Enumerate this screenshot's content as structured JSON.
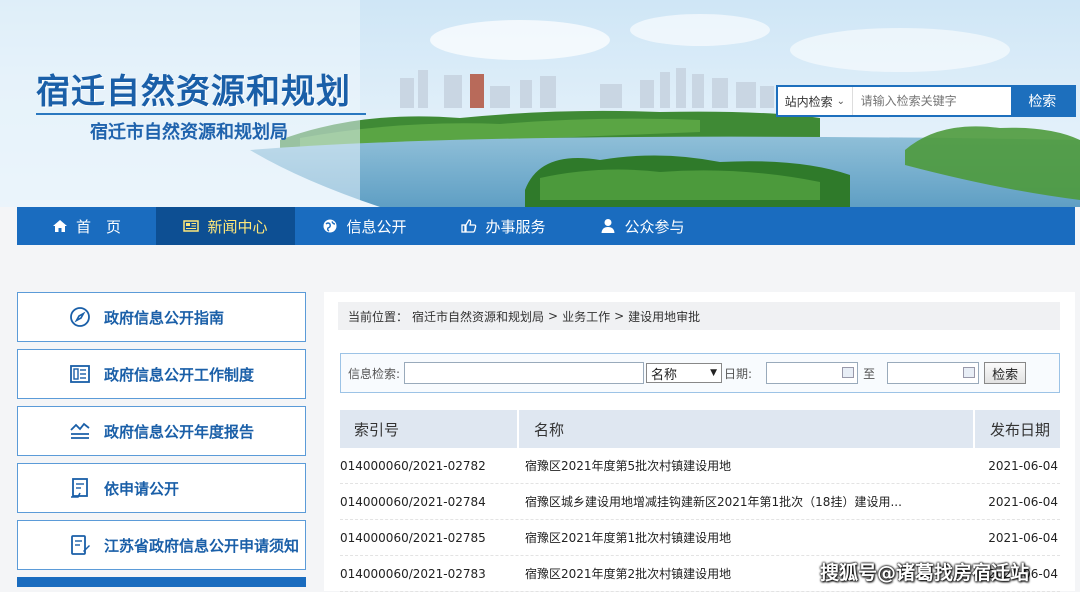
{
  "header": {
    "site_title": "宿迁自然资源和规划",
    "site_subtitle": "宿迁市自然资源和规划局",
    "search": {
      "scope_label": "站内检索",
      "placeholder": "请输入检索关键字",
      "button_label": "检索"
    }
  },
  "nav": {
    "items": [
      {
        "label": "首　页",
        "icon": "home-icon"
      },
      {
        "label": "新闻中心",
        "icon": "news-icon",
        "active": true
      },
      {
        "label": "信息公开",
        "icon": "globe-icon"
      },
      {
        "label": "办事服务",
        "icon": "thumbs-up-icon"
      },
      {
        "label": "公众参与",
        "icon": "user-icon"
      }
    ]
  },
  "sidebar": {
    "items": [
      {
        "label": "政府信息公开指南",
        "icon": "compass-icon"
      },
      {
        "label": "政府信息公开工作制度",
        "icon": "document-icon"
      },
      {
        "label": "政府信息公开年度报告",
        "icon": "report-icon"
      },
      {
        "label": "依申请公开",
        "icon": "apply-icon"
      },
      {
        "label": "江苏省政府信息公开申请须知",
        "icon": "notice-icon"
      }
    ]
  },
  "breadcrumb": {
    "prefix": "当前位置：",
    "items": [
      "宿迁市自然资源和规划局",
      "业务工作",
      "建设用地审批"
    ],
    "separator": ">"
  },
  "filter": {
    "search_label": "信息检索:",
    "field_value": "名称",
    "date_label": "日期:",
    "to_label": "至",
    "button_label": "检索"
  },
  "table": {
    "headers": [
      "索引号",
      "名称",
      "发布日期"
    ],
    "rows": [
      {
        "index": "014000060/2021-02782",
        "name": "宿豫区2021年度第5批次村镇建设用地",
        "date": "2021-06-04"
      },
      {
        "index": "014000060/2021-02784",
        "name": "宿豫区城乡建设用地增减挂钩建新区2021年第1批次（18挂）建设用...",
        "date": "2021-06-04"
      },
      {
        "index": "014000060/2021-02785",
        "name": "宿豫区2021年度第1批次村镇建设用地",
        "date": "2021-06-04"
      },
      {
        "index": "014000060/2021-02783",
        "name": "宿豫区2021年度第2批次村镇建设用地",
        "date": "2021-06-04"
      }
    ]
  },
  "watermark": "搜狐号@诸葛找房宿迁站",
  "colors": {
    "primary_blue": "#1a6cbf",
    "nav_active_bg": "#0d4f93",
    "nav_active_text": "#ffe87a",
    "title_blue": "#1a5fa8"
  }
}
